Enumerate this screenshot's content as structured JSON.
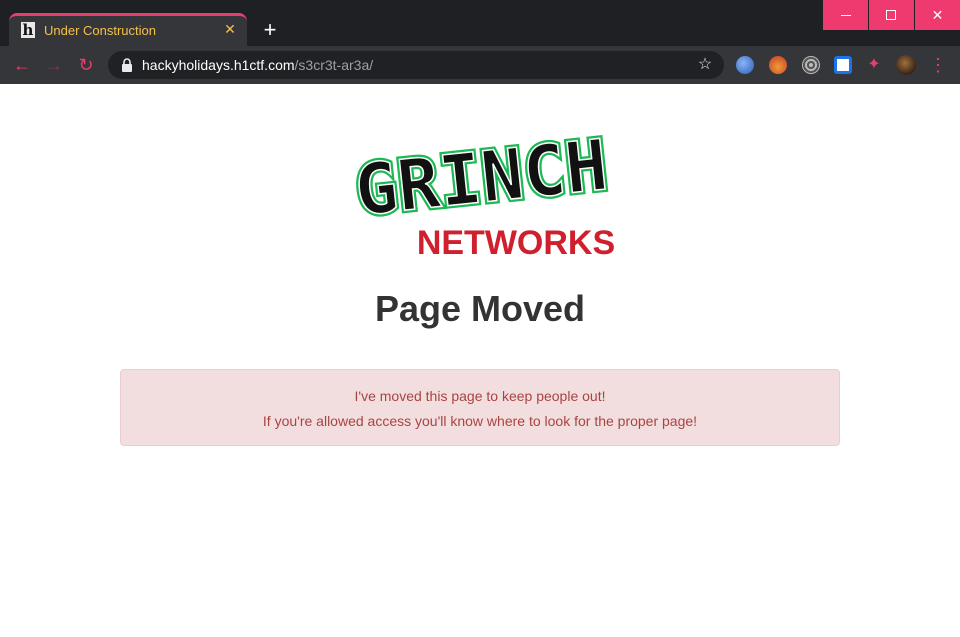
{
  "browser": {
    "tab": {
      "title": "Under Construction",
      "favicon_text": "h",
      "close_label": "✕"
    },
    "new_tab_label": "+",
    "window_controls": {
      "minimize": "",
      "maximize": "",
      "close": "✕"
    },
    "nav": {
      "back": "←",
      "forward": "→",
      "reload": "↻"
    },
    "address": {
      "host": "hackyholidays.h1ctf.com",
      "path": "/s3cr3t-ar3a/"
    },
    "bookmark_icon": "☆",
    "menu_icon": "⋮",
    "extensions_icon": "✦"
  },
  "page": {
    "logo": {
      "text_top": "GRINCH",
      "text_bottom": "NETWORKS"
    },
    "heading": "Page Moved",
    "alert": {
      "line1": "I've moved this page to keep people out!",
      "line2": "If you're allowed access you'll know where to look for the proper page!"
    }
  },
  "colors": {
    "accent": "#e83e6c",
    "tab_title": "#f5c14b",
    "alert_bg": "#f2dede",
    "alert_text": "#a94442",
    "logo_green": "#1db954",
    "logo_red": "#d0202e"
  }
}
